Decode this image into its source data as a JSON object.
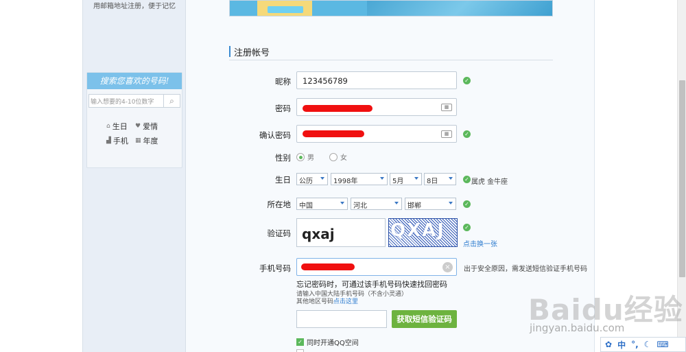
{
  "sidebar": {
    "top_note": "用邮箱地址注册，便于记忆",
    "search": {
      "title": "搜索您喜欢的号码!",
      "placeholder": "输入想要的4-10位数字",
      "chips": [
        "生日",
        "爱情",
        "手机",
        "年度"
      ]
    }
  },
  "form": {
    "section_title": "注册帐号",
    "nickname": {
      "label": "昵称",
      "value": "123456789"
    },
    "password": {
      "label": "密码"
    },
    "confirm_password": {
      "label": "确认密码"
    },
    "gender": {
      "label": "性别",
      "options": [
        "男",
        "女"
      ],
      "selected": "男"
    },
    "birthday": {
      "label": "生日",
      "calendar": "公历",
      "year": "1998年",
      "month": "5月",
      "day": "8日",
      "hint": "属虎 金牛座"
    },
    "location": {
      "label": "所在地",
      "country": "中国",
      "province": "河北",
      "city": "邯郸"
    },
    "captcha": {
      "label": "验证码",
      "value": "qxaj",
      "image_text": "QXAJ",
      "refresh": "点击换一张"
    },
    "phone": {
      "label": "手机号码",
      "side_hint": "出于安全原因，需发送短信验证手机号码",
      "hint_main": "忘记密码时，可通过该手机号码快速找回密码",
      "hint_sub": "请输入中国大陆手机号码（不含小灵通）",
      "hint_other_prefix": "其他地区号码",
      "hint_other_link": "点击这里"
    },
    "sms_button": "获取短信验证码",
    "qq_space": "同时开通QQ空间"
  },
  "watermark": {
    "brand": "Baidu经验",
    "url": "jingyan.baidu.com"
  },
  "ime": [
    "中",
    "°,",
    "☾",
    "⌨"
  ]
}
